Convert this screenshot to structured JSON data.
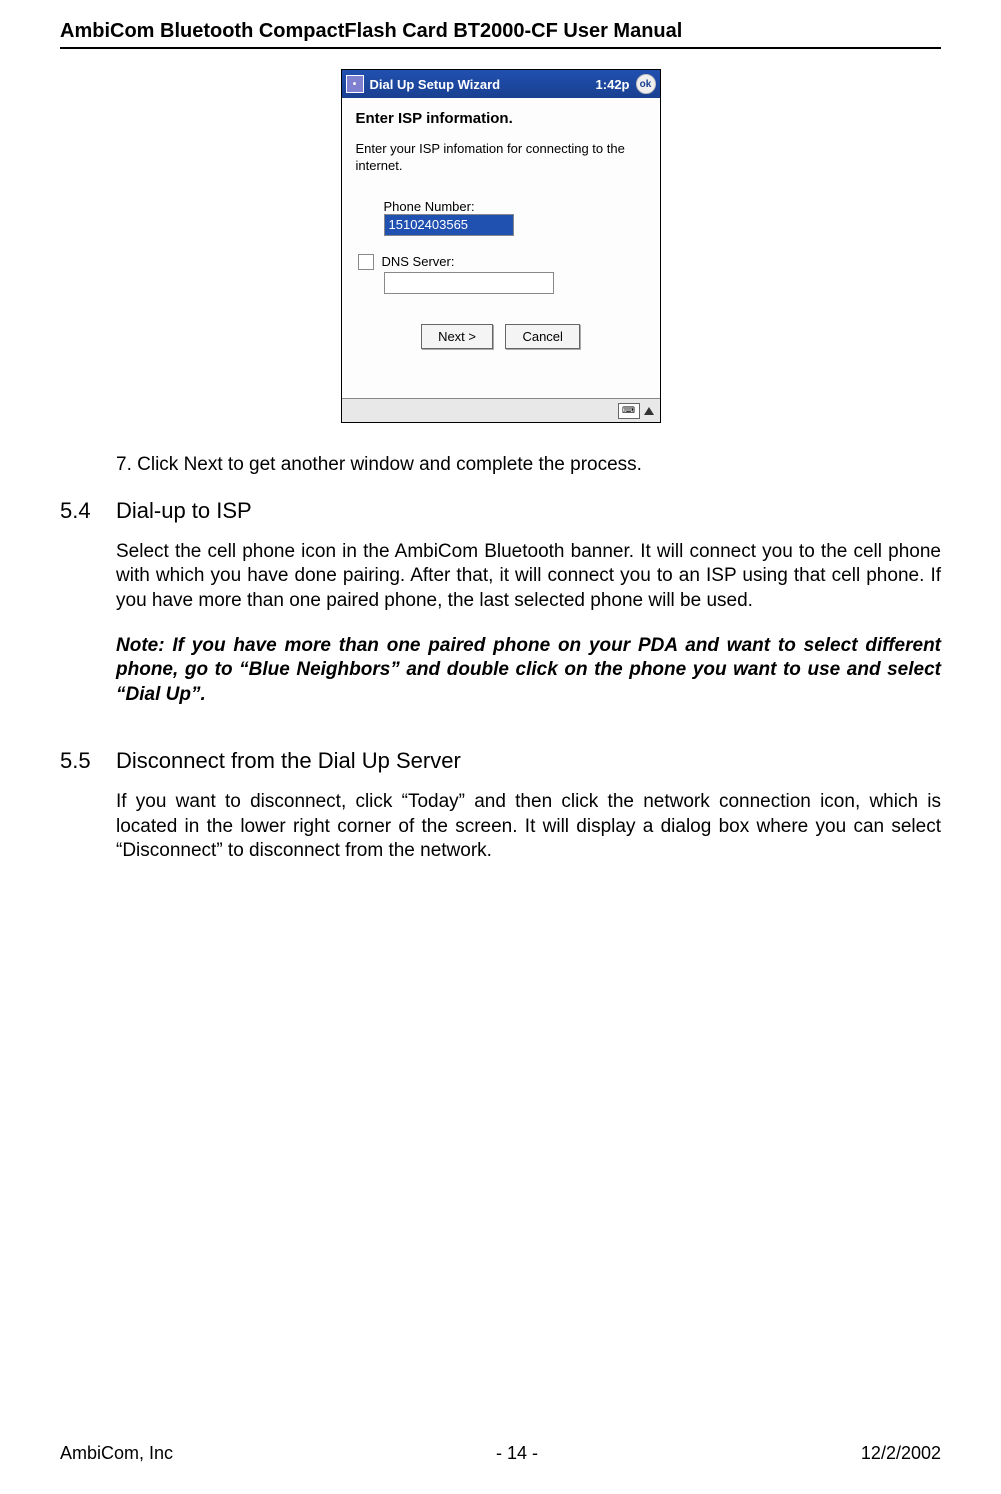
{
  "doc_title": "AmbiCom Bluetooth CompactFlash Card BT2000-CF User Manual",
  "pda": {
    "window_title": "Dial Up Setup Wizard",
    "clock": "1:42p",
    "ok": "ok",
    "heading": "Enter ISP information.",
    "subtext": "Enter your ISP infomation for connecting to the internet.",
    "phone_label": "Phone Number:",
    "phone_value": "15102403565",
    "dns_label": "DNS Server:",
    "dns_value": "",
    "next_btn": "Next >",
    "cancel_btn": "Cancel"
  },
  "step7": "7. Click Next to get another window and complete the process.",
  "section_54": {
    "num": "5.4",
    "title": "Dial-up to ISP",
    "body": "Select the cell phone icon in the AmbiCom Bluetooth banner. It will connect you to the cell phone with which you have done pairing. After that, it will connect you to an ISP using that cell phone.  If you have more than one paired phone, the last selected phone will be used.",
    "note": "Note:  If you have more than one paired phone on your PDA and want to select different phone, go to “Blue Neighbors” and double click on the phone you want to use and select  “Dial Up”."
  },
  "section_55": {
    "num": "5.5",
    "title": "Disconnect from the Dial Up Server",
    "body": "If you want to disconnect, click “Today” and then click the network connection icon, which is located in the lower right corner of the screen.  It will display a dialog box where you can select “Disconnect” to disconnect from the network."
  },
  "footer": {
    "left": "AmbiCom, Inc",
    "center": "- 14 -",
    "right": "12/2/2002"
  }
}
